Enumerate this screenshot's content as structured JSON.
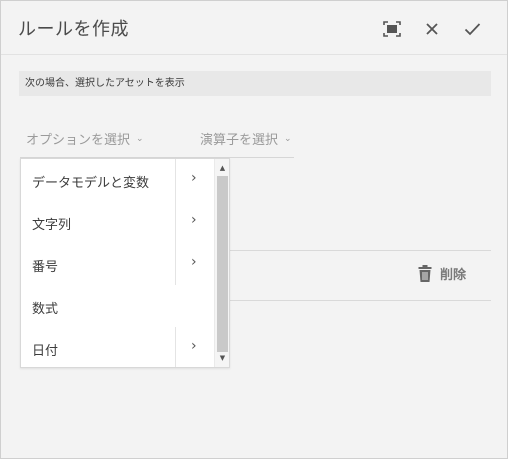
{
  "dialog": {
    "title": "ルールを作成",
    "toolbar": {
      "maximize_icon": "maximize-icon",
      "close_icon": "close-icon",
      "confirm_icon": "check-icon"
    }
  },
  "rule": {
    "section_label": "次の場合、選択したアセットを表示",
    "option_placeholder": "オプションを選択",
    "operator_placeholder": "演算子を選択",
    "delete_label": "削除"
  },
  "menu": {
    "items": [
      {
        "label": "データモデルと変数",
        "has_submenu": true
      },
      {
        "label": "文字列",
        "has_submenu": true
      },
      {
        "label": "番号",
        "has_submenu": true
      },
      {
        "label": "数式",
        "has_submenu": false
      },
      {
        "label": "日付",
        "has_submenu": true
      }
    ]
  },
  "colors": {
    "background": "#f3f3f3",
    "menu_background": "#ffffff",
    "label_band": "#e8e8e8",
    "muted_text": "#9a9a9a"
  }
}
